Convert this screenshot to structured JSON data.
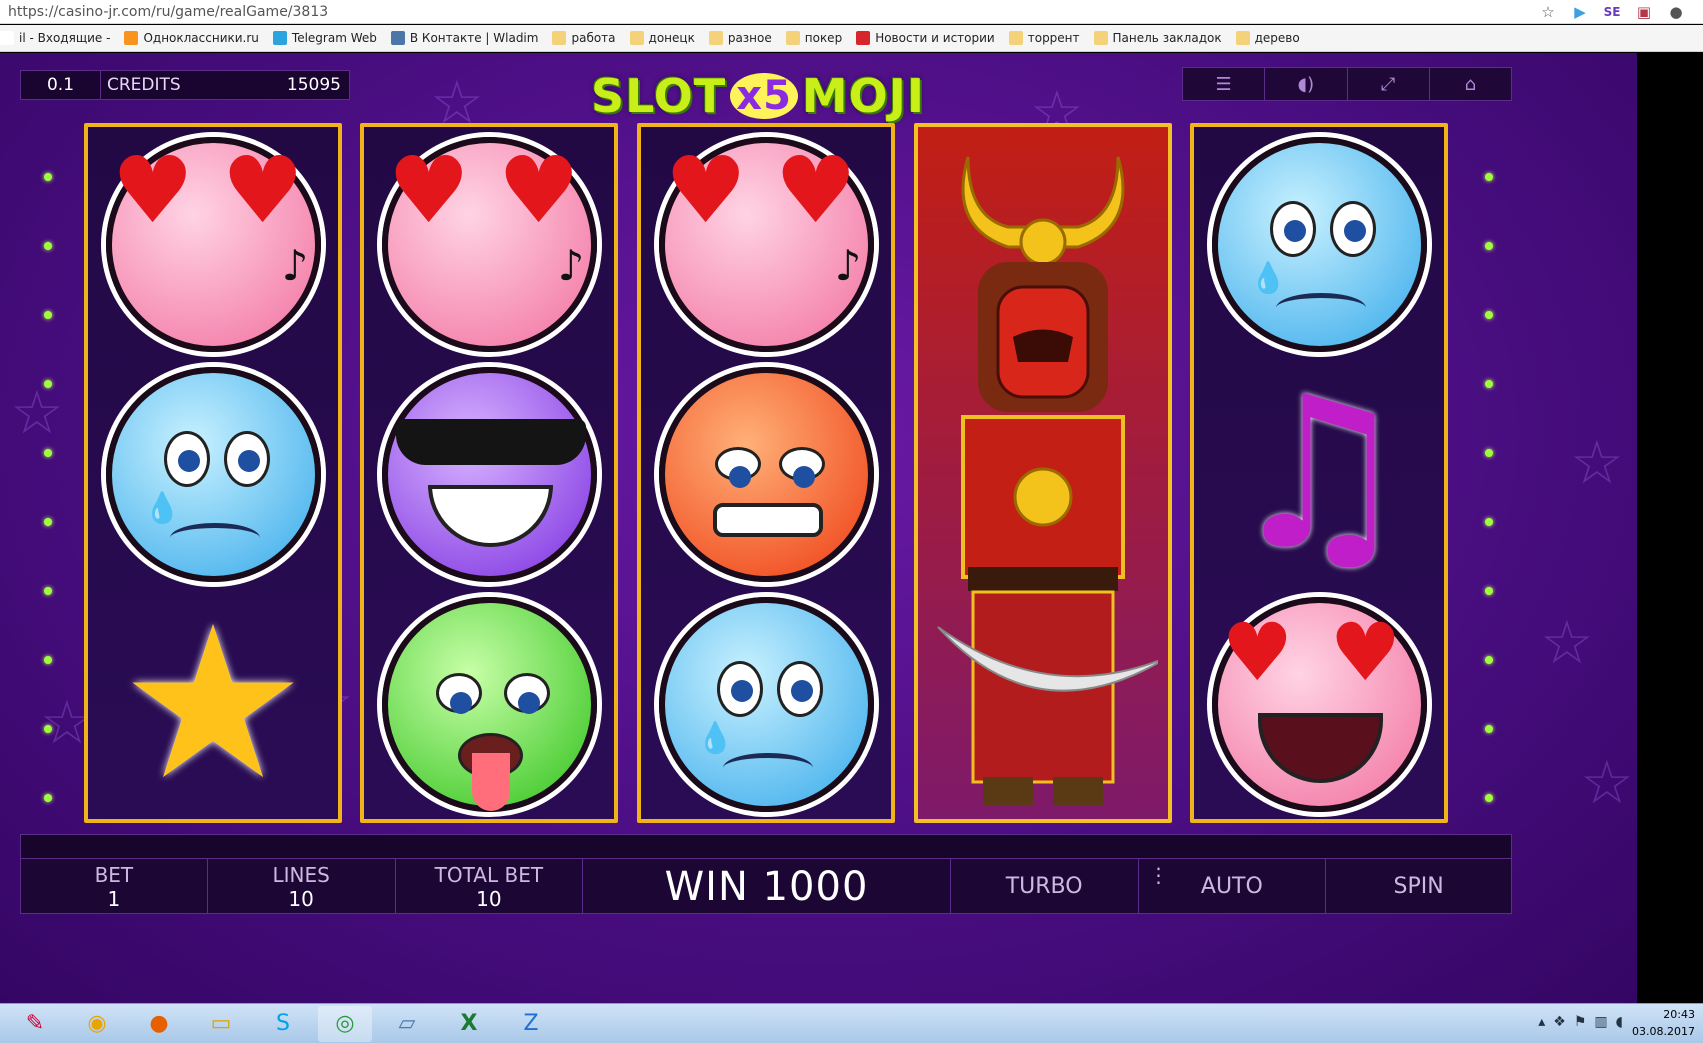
{
  "browser": {
    "url": "https://casino-jr.com/ru/game/realGame/3813",
    "toolbar_icons": [
      "star-icon",
      "play-icon",
      "extension-icon",
      "screenshot-icon",
      "profile-icon"
    ],
    "bookmarks": [
      {
        "label": "il - Входящие - ",
        "icon": "mail-icon",
        "color": "#ffffff"
      },
      {
        "label": "Одноклассники.ru",
        "icon": "ok-icon",
        "color": "#f7931e"
      },
      {
        "label": "Telegram Web",
        "icon": "telegram-icon",
        "color": "#2aa3df"
      },
      {
        "label": "В Контакте | Wladim",
        "icon": "vk-icon",
        "color": "#4a76a8"
      },
      {
        "label": "работа",
        "icon": "folder-icon",
        "color": "#f3d27a"
      },
      {
        "label": "донецк",
        "icon": "folder-icon",
        "color": "#f3d27a"
      },
      {
        "label": "разное",
        "icon": "folder-icon",
        "color": "#f3d27a"
      },
      {
        "label": "покер",
        "icon": "folder-icon",
        "color": "#f3d27a"
      },
      {
        "label": "Новости и истории ",
        "icon": "news-icon",
        "color": "#d7262b"
      },
      {
        "label": "торрент",
        "icon": "folder-icon",
        "color": "#f3d27a"
      },
      {
        "label": "Панель закладок",
        "icon": "folder-icon",
        "color": "#f3d27a"
      },
      {
        "label": "дерево",
        "icon": "folder-icon",
        "color": "#f3d27a"
      }
    ]
  },
  "game": {
    "logo_left": "SLOT",
    "logo_x5": "x5",
    "logo_right": "MOJI",
    "hud": {
      "bet_value": "0.1",
      "credits_label": "CREDITS",
      "credits_value": "15095"
    },
    "top_buttons": [
      {
        "name": "menu-button",
        "icon": "☰"
      },
      {
        "name": "sound-button",
        "icon": "🔊"
      },
      {
        "name": "fullscreen-button",
        "icon": "⤢"
      },
      {
        "name": "home-button",
        "icon": "⌂"
      }
    ],
    "reels": [
      [
        "love-face",
        "sad-face",
        "star"
      ],
      [
        "love-face",
        "cool-face",
        "sick-face"
      ],
      [
        "love-face",
        "angry-face",
        "sad-face"
      ],
      [
        "samurai"
      ],
      [
        "sad-face",
        "music-note",
        "happy-love-face"
      ]
    ],
    "bottom": {
      "bet_label": "BET",
      "bet_value": "1",
      "lines_label": "LINES",
      "lines_value": "10",
      "total_label": "TOTAL BET",
      "total_value": "10",
      "win_text": "WIN 1000",
      "turbo": "TURBO",
      "auto": "AUTO",
      "spin": "SPIN"
    }
  },
  "taskbar": {
    "apps": [
      "paint-icon",
      "messenger-icon",
      "firefox-icon",
      "explorer-icon",
      "skype-icon",
      "chrome-icon",
      "notepad-icon",
      "excel-icon",
      "app-icon"
    ],
    "time": "20:43",
    "date": "03.08.2017"
  }
}
